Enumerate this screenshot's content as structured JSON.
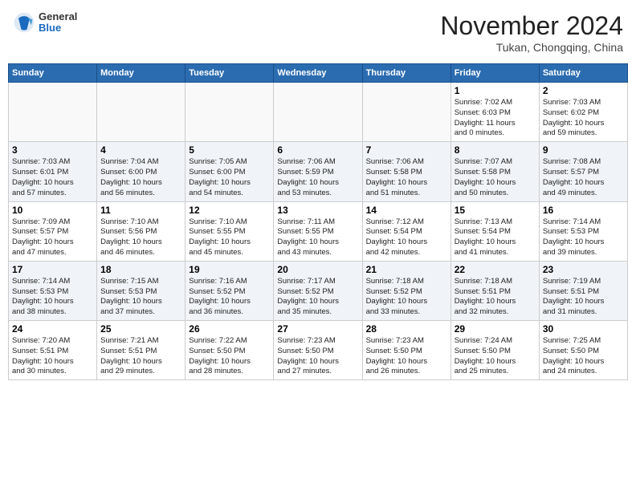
{
  "header": {
    "logo_general": "General",
    "logo_blue": "Blue",
    "month_title": "November 2024",
    "location": "Tukan, Chongqing, China"
  },
  "weekdays": [
    "Sunday",
    "Monday",
    "Tuesday",
    "Wednesday",
    "Thursday",
    "Friday",
    "Saturday"
  ],
  "weeks": [
    [
      {
        "day": "",
        "info": ""
      },
      {
        "day": "",
        "info": ""
      },
      {
        "day": "",
        "info": ""
      },
      {
        "day": "",
        "info": ""
      },
      {
        "day": "",
        "info": ""
      },
      {
        "day": "1",
        "info": "Sunrise: 7:02 AM\nSunset: 6:03 PM\nDaylight: 11 hours\nand 0 minutes."
      },
      {
        "day": "2",
        "info": "Sunrise: 7:03 AM\nSunset: 6:02 PM\nDaylight: 10 hours\nand 59 minutes."
      }
    ],
    [
      {
        "day": "3",
        "info": "Sunrise: 7:03 AM\nSunset: 6:01 PM\nDaylight: 10 hours\nand 57 minutes."
      },
      {
        "day": "4",
        "info": "Sunrise: 7:04 AM\nSunset: 6:00 PM\nDaylight: 10 hours\nand 56 minutes."
      },
      {
        "day": "5",
        "info": "Sunrise: 7:05 AM\nSunset: 6:00 PM\nDaylight: 10 hours\nand 54 minutes."
      },
      {
        "day": "6",
        "info": "Sunrise: 7:06 AM\nSunset: 5:59 PM\nDaylight: 10 hours\nand 53 minutes."
      },
      {
        "day": "7",
        "info": "Sunrise: 7:06 AM\nSunset: 5:58 PM\nDaylight: 10 hours\nand 51 minutes."
      },
      {
        "day": "8",
        "info": "Sunrise: 7:07 AM\nSunset: 5:58 PM\nDaylight: 10 hours\nand 50 minutes."
      },
      {
        "day": "9",
        "info": "Sunrise: 7:08 AM\nSunset: 5:57 PM\nDaylight: 10 hours\nand 49 minutes."
      }
    ],
    [
      {
        "day": "10",
        "info": "Sunrise: 7:09 AM\nSunset: 5:57 PM\nDaylight: 10 hours\nand 47 minutes."
      },
      {
        "day": "11",
        "info": "Sunrise: 7:10 AM\nSunset: 5:56 PM\nDaylight: 10 hours\nand 46 minutes."
      },
      {
        "day": "12",
        "info": "Sunrise: 7:10 AM\nSunset: 5:55 PM\nDaylight: 10 hours\nand 45 minutes."
      },
      {
        "day": "13",
        "info": "Sunrise: 7:11 AM\nSunset: 5:55 PM\nDaylight: 10 hours\nand 43 minutes."
      },
      {
        "day": "14",
        "info": "Sunrise: 7:12 AM\nSunset: 5:54 PM\nDaylight: 10 hours\nand 42 minutes."
      },
      {
        "day": "15",
        "info": "Sunrise: 7:13 AM\nSunset: 5:54 PM\nDaylight: 10 hours\nand 41 minutes."
      },
      {
        "day": "16",
        "info": "Sunrise: 7:14 AM\nSunset: 5:53 PM\nDaylight: 10 hours\nand 39 minutes."
      }
    ],
    [
      {
        "day": "17",
        "info": "Sunrise: 7:14 AM\nSunset: 5:53 PM\nDaylight: 10 hours\nand 38 minutes."
      },
      {
        "day": "18",
        "info": "Sunrise: 7:15 AM\nSunset: 5:53 PM\nDaylight: 10 hours\nand 37 minutes."
      },
      {
        "day": "19",
        "info": "Sunrise: 7:16 AM\nSunset: 5:52 PM\nDaylight: 10 hours\nand 36 minutes."
      },
      {
        "day": "20",
        "info": "Sunrise: 7:17 AM\nSunset: 5:52 PM\nDaylight: 10 hours\nand 35 minutes."
      },
      {
        "day": "21",
        "info": "Sunrise: 7:18 AM\nSunset: 5:52 PM\nDaylight: 10 hours\nand 33 minutes."
      },
      {
        "day": "22",
        "info": "Sunrise: 7:18 AM\nSunset: 5:51 PM\nDaylight: 10 hours\nand 32 minutes."
      },
      {
        "day": "23",
        "info": "Sunrise: 7:19 AM\nSunset: 5:51 PM\nDaylight: 10 hours\nand 31 minutes."
      }
    ],
    [
      {
        "day": "24",
        "info": "Sunrise: 7:20 AM\nSunset: 5:51 PM\nDaylight: 10 hours\nand 30 minutes."
      },
      {
        "day": "25",
        "info": "Sunrise: 7:21 AM\nSunset: 5:51 PM\nDaylight: 10 hours\nand 29 minutes."
      },
      {
        "day": "26",
        "info": "Sunrise: 7:22 AM\nSunset: 5:50 PM\nDaylight: 10 hours\nand 28 minutes."
      },
      {
        "day": "27",
        "info": "Sunrise: 7:23 AM\nSunset: 5:50 PM\nDaylight: 10 hours\nand 27 minutes."
      },
      {
        "day": "28",
        "info": "Sunrise: 7:23 AM\nSunset: 5:50 PM\nDaylight: 10 hours\nand 26 minutes."
      },
      {
        "day": "29",
        "info": "Sunrise: 7:24 AM\nSunset: 5:50 PM\nDaylight: 10 hours\nand 25 minutes."
      },
      {
        "day": "30",
        "info": "Sunrise: 7:25 AM\nSunset: 5:50 PM\nDaylight: 10 hours\nand 24 minutes."
      }
    ]
  ]
}
